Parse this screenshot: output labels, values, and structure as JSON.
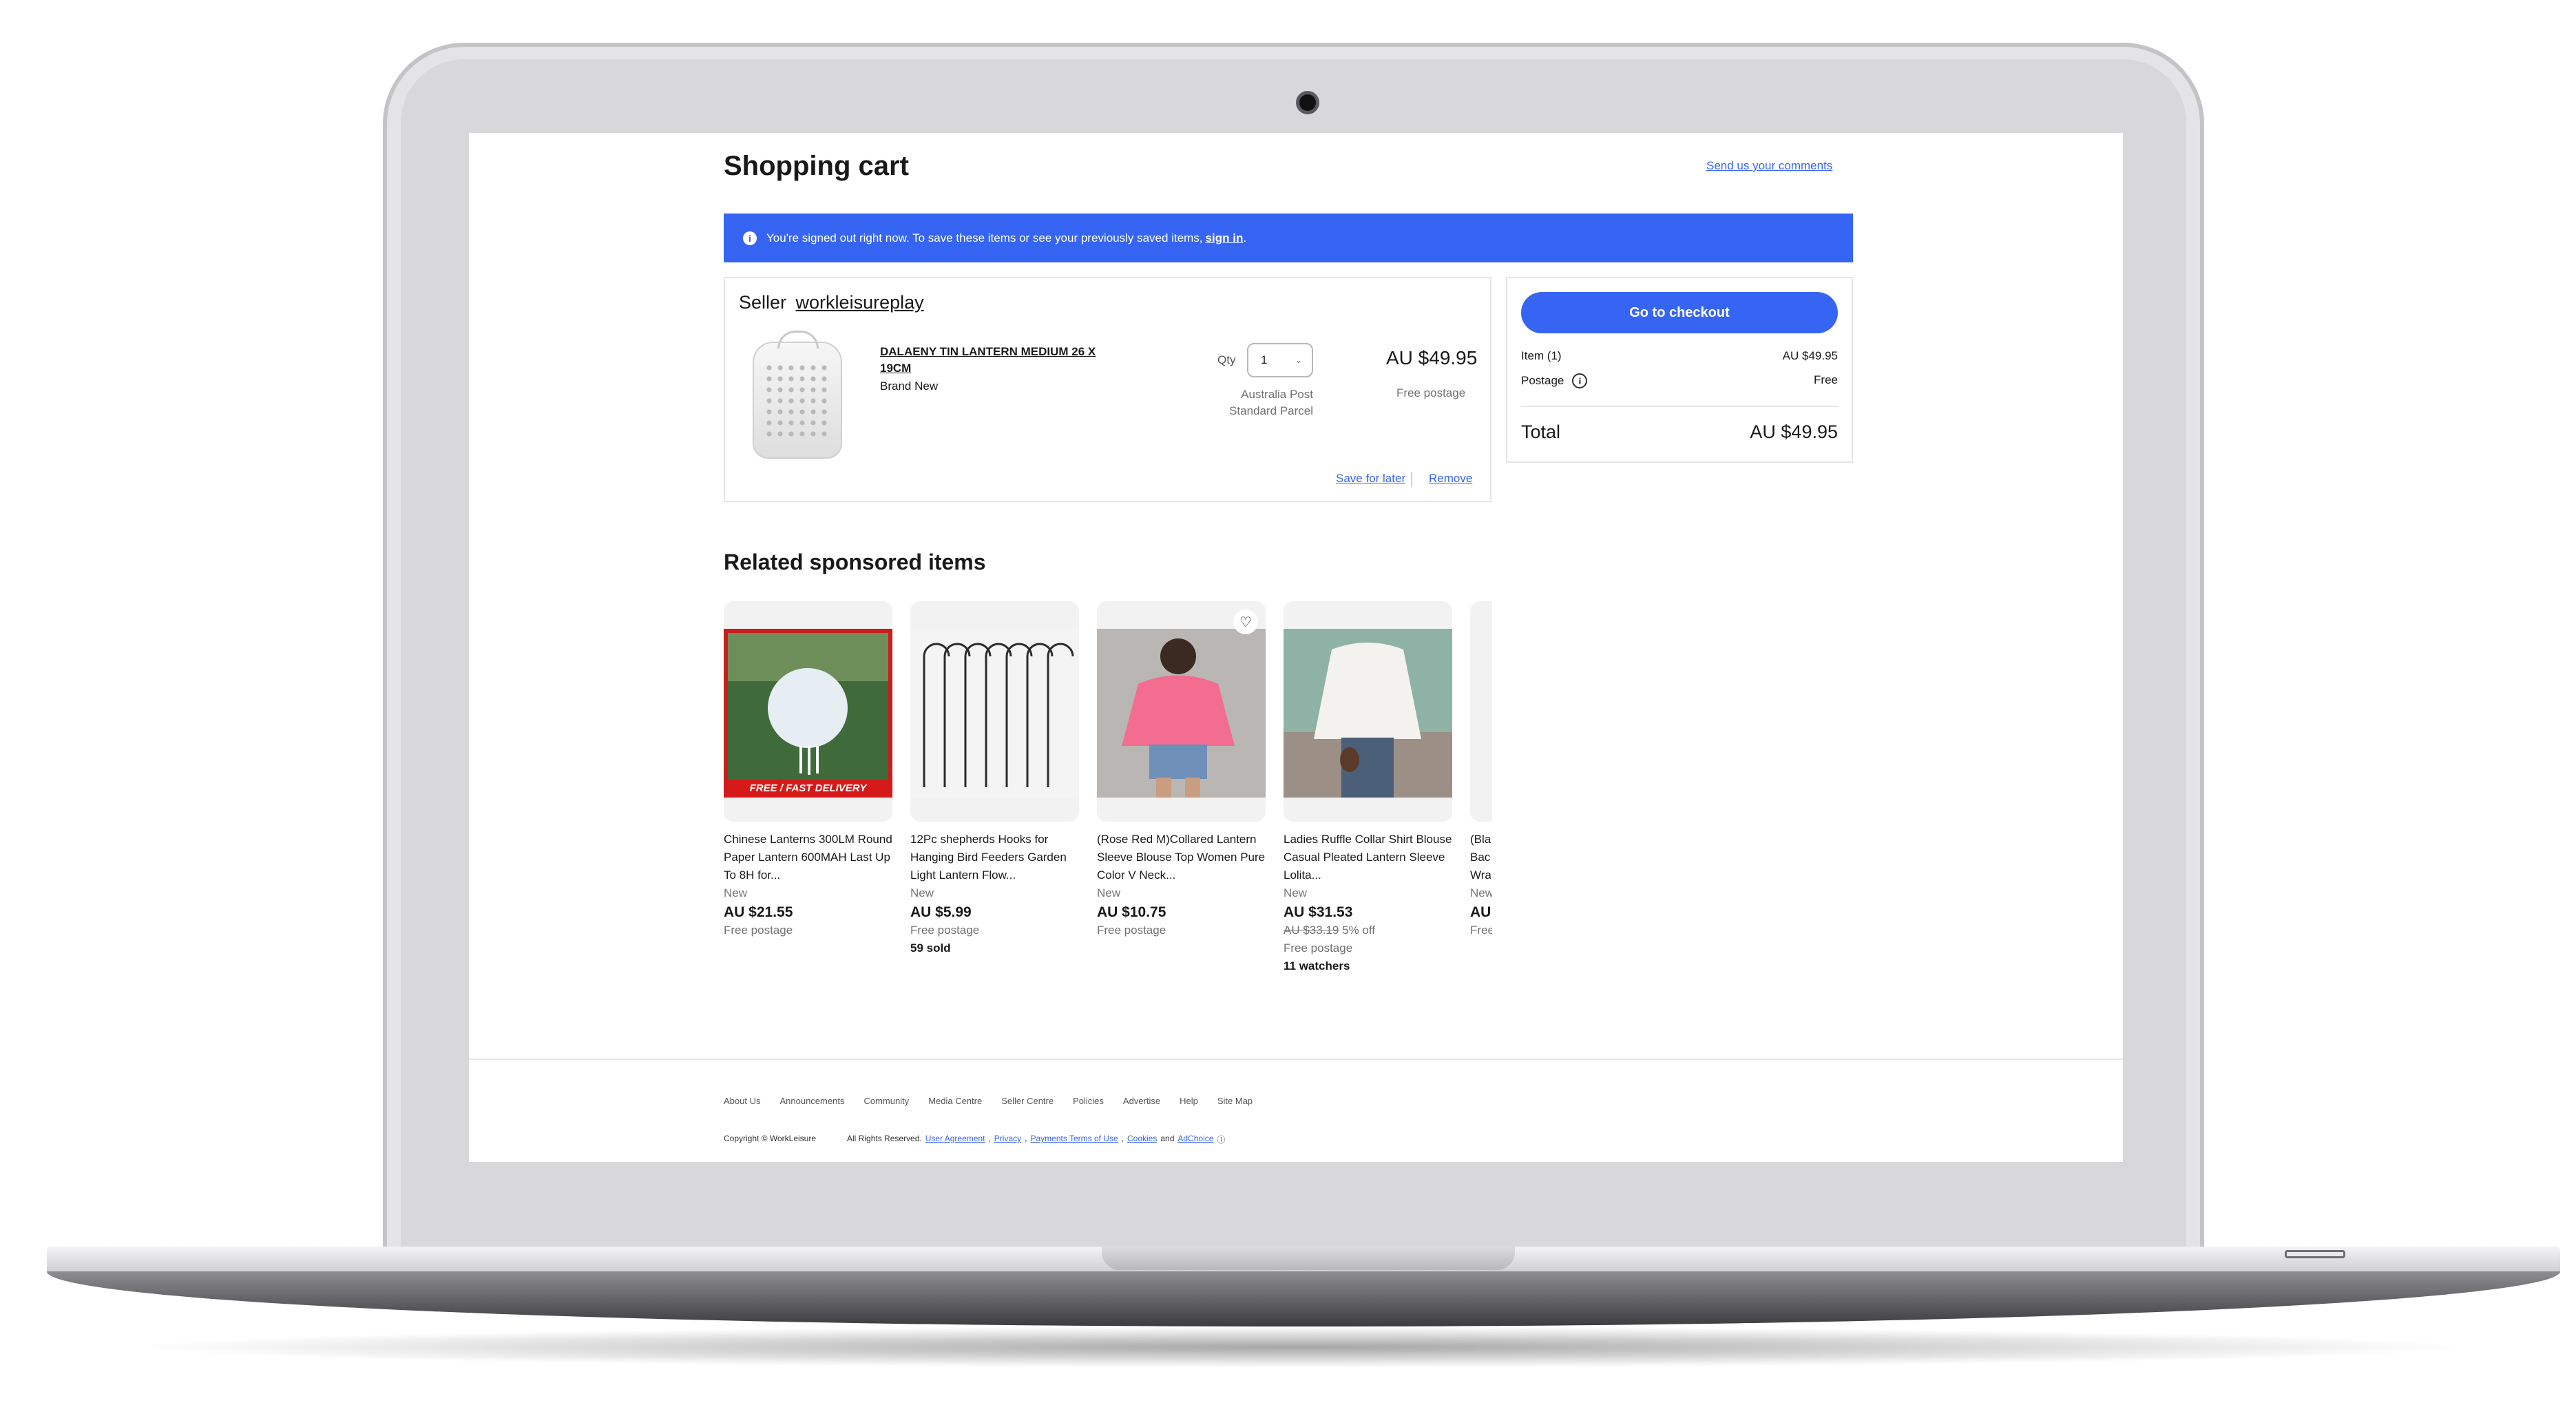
{
  "page": {
    "title": "Shopping cart",
    "comments_link": "Send us your comments"
  },
  "banner": {
    "message": "You're signed out right now. To save these items or see your previously saved items,",
    "signin_link": "sign in",
    "signin_suffix": "."
  },
  "cart": {
    "seller_label": "Seller",
    "seller_name": "workleisureplay",
    "item": {
      "title": "DALAENY TIN LANTERN MEDIUM 26 X 19CM",
      "condition": "Brand New",
      "qty_label": "Qty",
      "qty_value": "1",
      "price": "AU $49.95",
      "shipping_method": "Australia Post Standard Parcel",
      "shipping_cost": "Free postage"
    },
    "save_for_later": "Save for later",
    "remove": "Remove"
  },
  "summary": {
    "checkout_button": "Go to checkout",
    "items_label": "Item (1)",
    "items_value": "AU $49.95",
    "postage_label": "Postage",
    "postage_value": "Free",
    "total_label": "Total",
    "total_value": "AU $49.95"
  },
  "related": {
    "title": "Related sponsored items",
    "items": [
      {
        "title": "Chinese Lanterns 300LM Round Paper Lantern 600MAH Last Up To 8H for...",
        "condition": "New",
        "price": "AU $21.55",
        "postage": "Free postage",
        "badge": "FREE / FAST DELIVERY"
      },
      {
        "title": "12Pc shepherds Hooks for Hanging Bird Feeders Garden Light Lantern Flow...",
        "condition": "New",
        "price": "AU $5.99",
        "postage": "Free postage",
        "extra": "59 sold"
      },
      {
        "title": "(Rose Red M)Collared Lantern Sleeve Blouse Top Women Pure Color V Neck...",
        "condition": "New",
        "price": "AU $10.75",
        "postage": "Free postage"
      },
      {
        "title": "Ladies Ruffle Collar Shirt Blouse Casual Pleated Lantern Sleeve Lolita...",
        "condition": "New",
        "price": "AU $31.53",
        "original_price": "AU $33.19",
        "discount": "5% off",
        "postage": "Free postage",
        "extra": "11 watchers"
      },
      {
        "title": "(Bla Bac Wra",
        "condition": "New",
        "price": "AU",
        "postage": "Free"
      }
    ]
  },
  "footer": {
    "links": [
      "About Us",
      "Announcements",
      "Community",
      "Media Centre",
      "Seller Centre",
      "Policies",
      "Advertise",
      "Help",
      "Site Map"
    ],
    "copyright": "Copyright ©  WorkLeisure",
    "rights": "All Rights Reserved.",
    "user_agreement": "User Agreement",
    "privacy": "Privacy",
    "payments_terms": "Payments Terms of Use",
    "cookies": "Cookies",
    "and": "and",
    "adchoice": "AdChoice"
  },
  "colors": {
    "accent": "#3665f3",
    "banner_bg": "#3665f3",
    "text": "#191919"
  }
}
